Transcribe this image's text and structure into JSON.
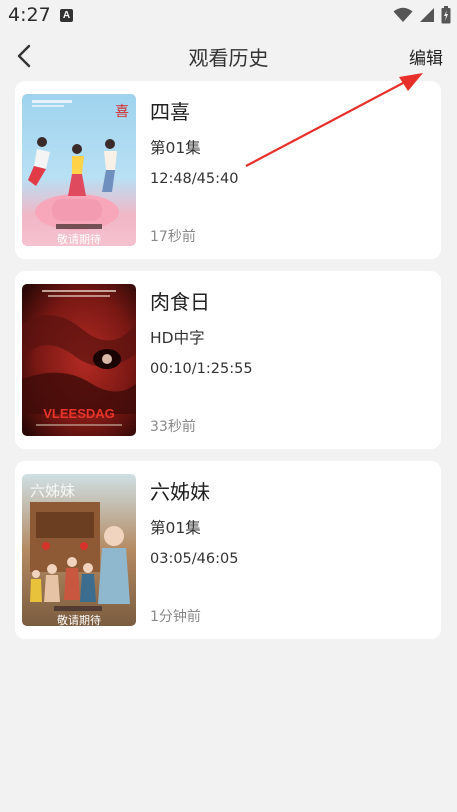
{
  "status_bar": {
    "time": "4:27",
    "app_icon_letter": "A"
  },
  "header": {
    "title": "观看历史",
    "edit_label": "编辑"
  },
  "history": [
    {
      "title": "四喜",
      "episode": "第01集",
      "progress": "12:48/45:40",
      "ago": "17秒前",
      "poster_caption": "敬请期待"
    },
    {
      "title": "肉食日",
      "episode": "HD中字",
      "progress": "00:10/1:25:55",
      "ago": "33秒前",
      "poster_caption": "VLEESDAG"
    },
    {
      "title": "六姊妹",
      "episode": "第01集",
      "progress": "03:05/46:05",
      "ago": "1分钟前",
      "poster_caption": "敬请期待",
      "poster_title": "六姊妹"
    }
  ],
  "colors": {
    "background": "#f2f2f2",
    "card": "#ffffff",
    "annotation_arrow": "#e8302a"
  }
}
